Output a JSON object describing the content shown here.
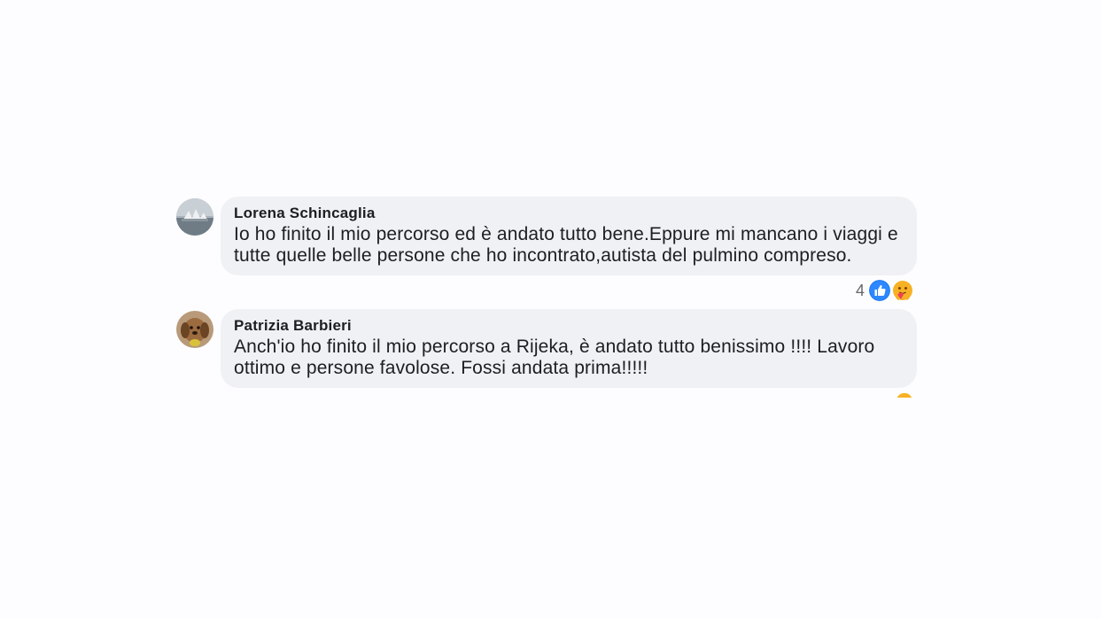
{
  "comments": [
    {
      "author": "Lorena Schincaglia",
      "text": "Io ho finito il mio percorso ed è andato tutto bene.Eppure mi mancano i viaggi e tutte quelle belle persone che ho incontrato,autista del pulmino compreso.",
      "reactions": {
        "count": "4",
        "icons": [
          "like-icon",
          "care-icon"
        ]
      }
    },
    {
      "author": "Patrizia Barbieri",
      "text": "Anch'io ho finito il mio percorso a Rijeka, è andato tutto benissimo !!!! Lavoro ottimo e persone favolose. Fossi andata prima!!!!!"
    }
  ],
  "colors": {
    "bubble": "#eff1f4",
    "text": "#1c1e21",
    "meta": "#65676b",
    "like": "#1877f2",
    "care": "#f7b125"
  }
}
